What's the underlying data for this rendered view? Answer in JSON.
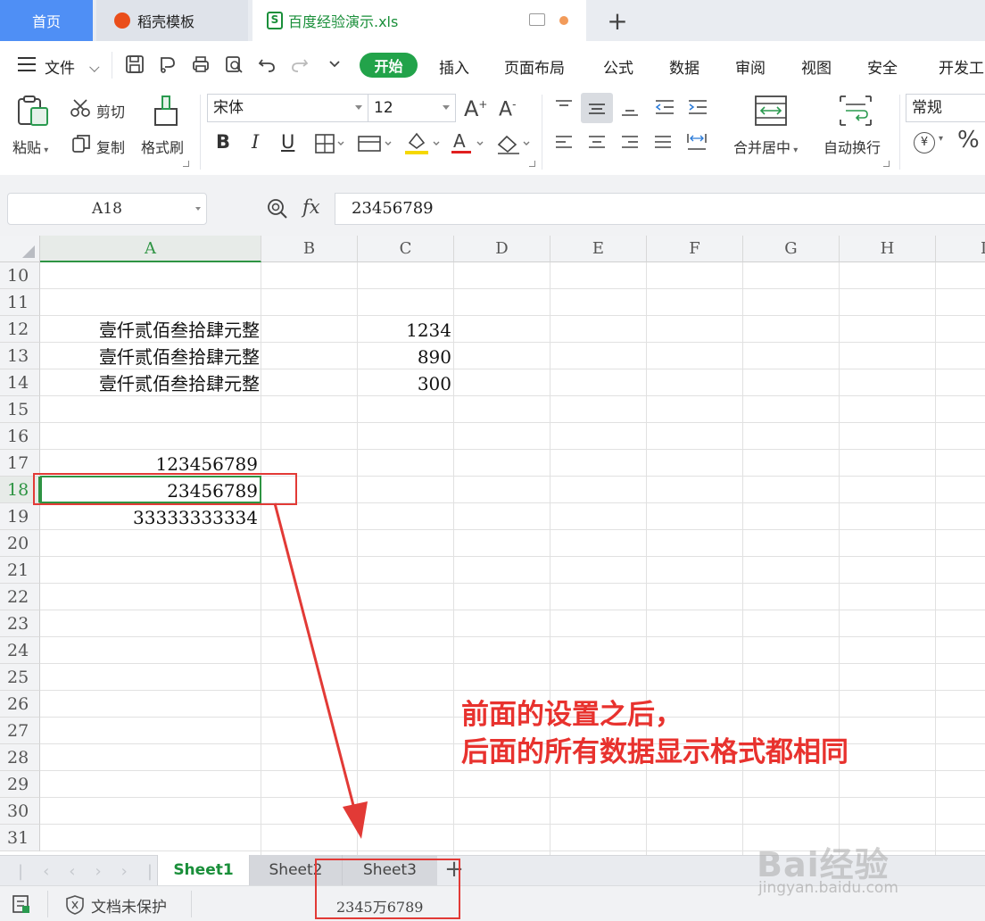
{
  "tabs": {
    "home": "首页",
    "template": "稻壳模板",
    "file": "百度经验演示.xls",
    "add": "+"
  },
  "menu": {
    "file": "文件",
    "start": "开始",
    "items": [
      "插入",
      "页面布局",
      "公式",
      "数据",
      "审阅",
      "视图",
      "安全",
      "开发工"
    ]
  },
  "ribbon": {
    "paste": "粘贴",
    "cut": "剪切",
    "copy": "复制",
    "format_painter": "格式刷",
    "font_name": "宋体",
    "font_size": "12",
    "bold": "B",
    "italic": "I",
    "underline": "U",
    "merge_center": "合并居中",
    "wrap_text": "自动换行",
    "number_format": "常规",
    "percent": "%",
    "currency": "¥"
  },
  "formula_bar": {
    "name_box": "A18",
    "fx": "fx",
    "value": "23456789"
  },
  "columns": [
    "A",
    "B",
    "C",
    "D",
    "E",
    "F",
    "G",
    "H",
    "I"
  ],
  "rows": [
    "10",
    "11",
    "12",
    "13",
    "14",
    "15",
    "16",
    "17",
    "18",
    "19",
    "20",
    "21",
    "22",
    "23",
    "24",
    "25",
    "26",
    "27",
    "28",
    "29",
    "30",
    "31"
  ],
  "active_cell": "A18",
  "cells": {
    "a12": "壹仟贰佰叁拾肆元整",
    "a13": "壹仟贰佰叁拾肆元整",
    "a14": "壹仟贰佰叁拾肆元整",
    "c12": "1234",
    "c13": "890",
    "c14": "300",
    "a17": "123456789",
    "a18": "23456789",
    "a19": "33333333334"
  },
  "annotation": {
    "line1": "前面的设置之后，",
    "line2": "后面的所有数据显示格式都相同"
  },
  "sheets": {
    "active": "Sheet1",
    "names": [
      "Sheet1",
      "Sheet2",
      "Sheet3"
    ],
    "add": "+"
  },
  "status": {
    "protection": "文档未保护",
    "display_value": "2345万6789"
  },
  "watermark": {
    "brand": "Bai经验",
    "url": "jingyan.baidu.com"
  },
  "colors": {
    "accent_blue": "#4f8ff5",
    "start_green": "#22a34a",
    "active_sheet": "#1a8f3a",
    "annotation_red": "#e8322e"
  }
}
